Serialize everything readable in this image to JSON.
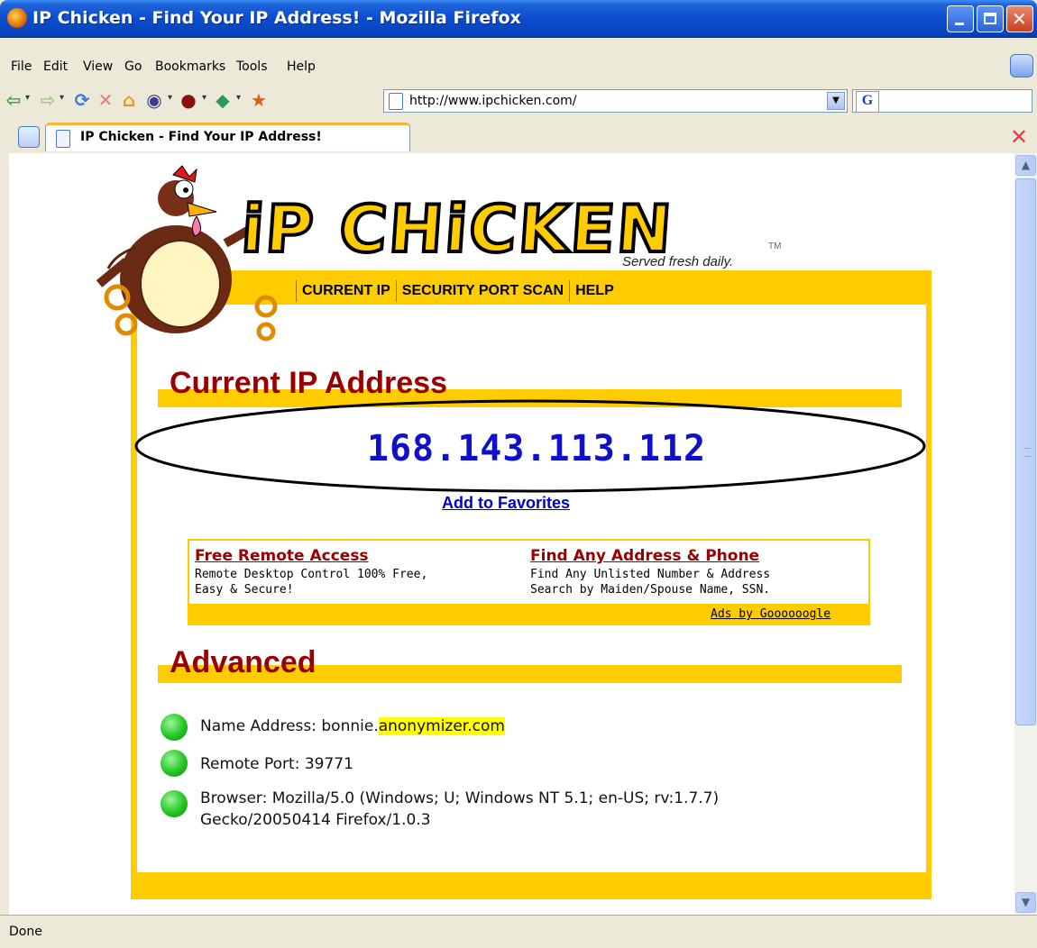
{
  "window": {
    "title": "IP Chicken - Find Your IP Address! - Mozilla Firefox"
  },
  "menu": [
    "File",
    "Edit",
    "View",
    "Go",
    "Bookmarks",
    "Tools",
    "Help"
  ],
  "address_bar": {
    "url": "http://www.ipchicken.com/"
  },
  "tab": {
    "label": "IP Chicken - Find Your IP Address!"
  },
  "page": {
    "logo_text": "iP CHiCKEN",
    "tagline": "Served fresh daily.",
    "tm": "TM",
    "nav": [
      "CURRENT IP",
      "SECURITY PORT SCAN",
      "HELP"
    ],
    "current_ip_heading": "Current IP Address",
    "ip_address": "168.143.113.112",
    "add_to_favorites": "Add to Favorites",
    "ads": [
      {
        "title": "Free Remote Access",
        "line1": "Remote Desktop Control 100% Free,",
        "line2": "Easy & Secure!"
      },
      {
        "title": "Find Any Address & Phone",
        "line1": "Find Any Unlisted Number & Address",
        "line2": "Search by Maiden/Spouse Name, SSN."
      }
    ],
    "ads_by": "Ads by Goooooogle",
    "advanced_heading": "Advanced",
    "advanced": {
      "name_address_label": "Name Address: bonnie.",
      "name_address_highlight": "anonymizer.com",
      "remote_port": "Remote Port: 39771",
      "browser_line1": "Browser: Mozilla/5.0 (Windows; U; Windows NT 5.1; en-US; rv:1.7.7)",
      "browser_line2": "Gecko/20050414 Firefox/1.0.3"
    }
  },
  "status": "Done",
  "colors": {
    "accent_yellow": "#FFCC00",
    "heading_red": "#990000",
    "ip_blue": "#1010CC",
    "highlight": "#FFFF00"
  }
}
